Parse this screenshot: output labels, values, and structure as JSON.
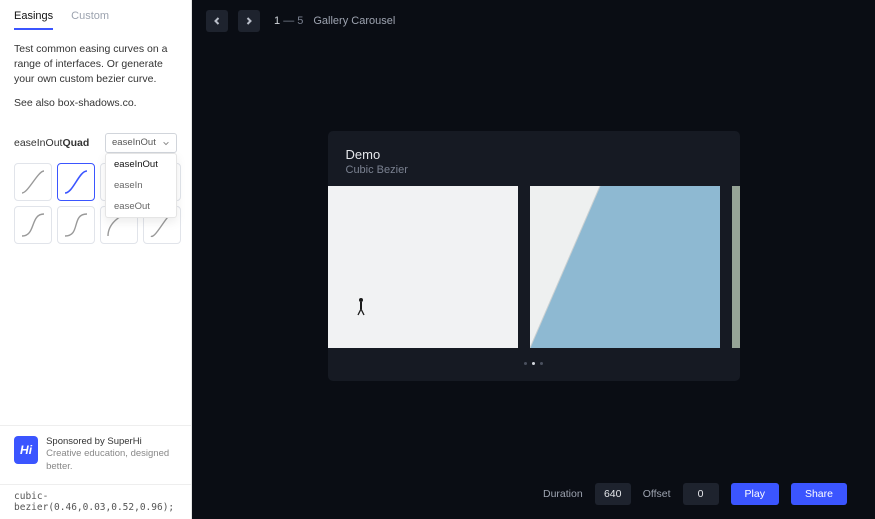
{
  "sidebar": {
    "tabs": {
      "easings": "Easings",
      "custom": "Custom"
    },
    "description_p1": "Test common easing curves on a range of interfaces. Or generate your own custom bezier curve.",
    "description_p2": "See also box-shadows.co.",
    "easing_name_prefix": "easeInOut",
    "easing_name_bold": "Quad",
    "dropdown_selected": "easeInOut",
    "dropdown_options": [
      "easeInOut",
      "easeIn",
      "easeOut"
    ],
    "sponsor": {
      "badge_text": "Hi",
      "line1": "Sponsored by SuperHi",
      "line2": "Creative education, designed better."
    },
    "bezier_code": "cubic-bezier(0.46,0.03,0.52,0.96);"
  },
  "topbar": {
    "current": "1",
    "total": "5",
    "separator": "—",
    "label": "Gallery Carousel"
  },
  "demo": {
    "title": "Demo",
    "subtitle": "Cubic Bezier",
    "dots_count": 3,
    "dots_active_index": 1,
    "slides": [
      {
        "type": "minimal-walker",
        "bg": "#f1f2f3"
      },
      {
        "type": "geometric-blue",
        "bg": "#7aa9c4"
      },
      {
        "type": "muted-green",
        "bg": "#8f9f92"
      }
    ]
  },
  "controls": {
    "duration_label": "Duration",
    "duration_value": "640",
    "offset_label": "Offset",
    "offset_value": "0",
    "play_label": "Play",
    "share_label": "Share"
  },
  "colors": {
    "accent": "#3b55ff",
    "panel": "#161a23",
    "bg": "#0a0d14"
  }
}
